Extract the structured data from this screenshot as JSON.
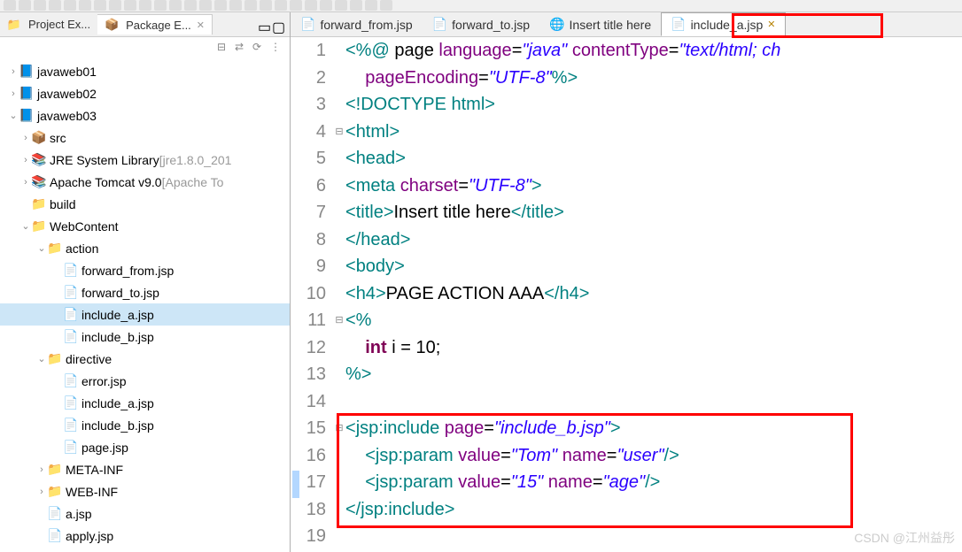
{
  "views": {
    "projectExplorer": "Project Ex...",
    "packageExplorer": "Package E..."
  },
  "tree": {
    "items": [
      {
        "type": "project",
        "label": "javaweb01",
        "expand": ">",
        "indent": 0
      },
      {
        "type": "project",
        "label": "javaweb02",
        "expand": ">",
        "indent": 0
      },
      {
        "type": "project",
        "label": "javaweb03",
        "expand": "v",
        "indent": 0
      },
      {
        "type": "src",
        "label": "src",
        "expand": ">",
        "indent": 1
      },
      {
        "type": "lib",
        "label": "JRE System Library",
        "suffix": " [jre1.8.0_201",
        "expand": ">",
        "indent": 1
      },
      {
        "type": "lib",
        "label": "Apache Tomcat v9.0",
        "suffix": " [Apache To",
        "expand": ">",
        "indent": 1
      },
      {
        "type": "folder",
        "label": "build",
        "expand": "",
        "indent": 1
      },
      {
        "type": "folder",
        "label": "WebContent",
        "expand": "v",
        "indent": 1
      },
      {
        "type": "folder",
        "label": "action",
        "expand": "v",
        "indent": 2
      },
      {
        "type": "jsp",
        "label": "forward_from.jsp",
        "expand": "",
        "indent": 3
      },
      {
        "type": "jsp",
        "label": "forward_to.jsp",
        "expand": "",
        "indent": 3
      },
      {
        "type": "jsp",
        "label": "include_a.jsp",
        "expand": "",
        "indent": 3,
        "selected": true
      },
      {
        "type": "jsp",
        "label": "include_b.jsp",
        "expand": "",
        "indent": 3
      },
      {
        "type": "folder",
        "label": "directive",
        "expand": "v",
        "indent": 2
      },
      {
        "type": "jsp",
        "label": "error.jsp",
        "expand": "",
        "indent": 3
      },
      {
        "type": "jsp",
        "label": "include_a.jsp",
        "expand": "",
        "indent": 3
      },
      {
        "type": "jsp",
        "label": "include_b.jsp",
        "expand": "",
        "indent": 3
      },
      {
        "type": "jsp",
        "label": "page.jsp",
        "expand": "",
        "indent": 3
      },
      {
        "type": "folder",
        "label": "META-INF",
        "expand": ">",
        "indent": 2
      },
      {
        "type": "folder",
        "label": "WEB-INF",
        "expand": ">",
        "indent": 2
      },
      {
        "type": "jsp",
        "label": "a.jsp",
        "expand": "",
        "indent": 2
      },
      {
        "type": "jsp",
        "label": "apply.jsp",
        "expand": "",
        "indent": 2
      }
    ]
  },
  "editorTabs": [
    {
      "label": "forward_from.jsp",
      "icon": "jsp"
    },
    {
      "label": "forward_to.jsp",
      "icon": "jsp"
    },
    {
      "label": "Insert title here",
      "icon": "web"
    },
    {
      "label": "include_a.jsp",
      "icon": "jsp",
      "active": true,
      "highlighted": true
    }
  ],
  "code": {
    "l1_a": "<%@",
    "l1_b": " page ",
    "l1_c": "language",
    "l1_d": "=",
    "l1_e": "\"java\"",
    "l1_f": " contentType",
    "l1_g": "=",
    "l1_h": "\"text/html; ch",
    "l2_a": "    ",
    "l2_b": "pageEncoding",
    "l2_c": "=",
    "l2_d": "\"UTF-8\"",
    "l2_e": "%>",
    "l3_a": "<!DOCTYPE ",
    "l3_b": "html",
    "l3_c": ">",
    "l4_a": "<",
    "l4_b": "html",
    "l4_c": ">",
    "l5_a": "<",
    "l5_b": "head",
    "l5_c": ">",
    "l6_a": "<",
    "l6_b": "meta",
    "l6_c": " charset",
    "l6_d": "=",
    "l6_e": "\"UTF-8\"",
    "l6_f": ">",
    "l7_a": "<",
    "l7_b": "title",
    "l7_c": ">",
    "l7_d": "Insert title here",
    "l7_e": "</",
    "l7_f": "title",
    "l7_g": ">",
    "l8_a": "</",
    "l8_b": "head",
    "l8_c": ">",
    "l9_a": "<",
    "l9_b": "body",
    "l9_c": ">",
    "l10_a": "<",
    "l10_b": "h4",
    "l10_c": ">",
    "l10_d": "PAGE ACTION AAA",
    "l10_e": "</",
    "l10_f": "h4",
    "l10_g": ">",
    "l11": "<%",
    "l12_a": "    ",
    "l12_b": "int",
    "l12_c": " i = 10;",
    "l13": "%>",
    "l14": "",
    "l15_a": "<",
    "l15_b": "jsp:include",
    "l15_c": " page",
    "l15_d": "=",
    "l15_e": "\"include_b.jsp\"",
    "l15_f": ">",
    "l16_a": "    <",
    "l16_b": "jsp:param",
    "l16_c": " value",
    "l16_d": "=",
    "l16_e": "\"Tom\"",
    "l16_f": " name",
    "l16_g": "=",
    "l16_h": "\"user\"",
    "l16_i": "/>",
    "l17_a": "    <",
    "l17_b": "jsp:param",
    "l17_c": " value",
    "l17_d": "=",
    "l17_e": "\"15\"",
    "l17_f": " name",
    "l17_g": "=",
    "l17_h": "\"age\"",
    "l17_i": "/>",
    "l18_a": "</",
    "l18_b": "jsp:include",
    "l18_c": ">",
    "l19": ""
  },
  "lineNumbers": [
    "1",
    "2",
    "3",
    "4",
    "5",
    "6",
    "7",
    "8",
    "9",
    "10",
    "11",
    "12",
    "13",
    "14",
    "15",
    "16",
    "17",
    "18",
    "19"
  ],
  "watermark": "CSDN @江州益彤"
}
